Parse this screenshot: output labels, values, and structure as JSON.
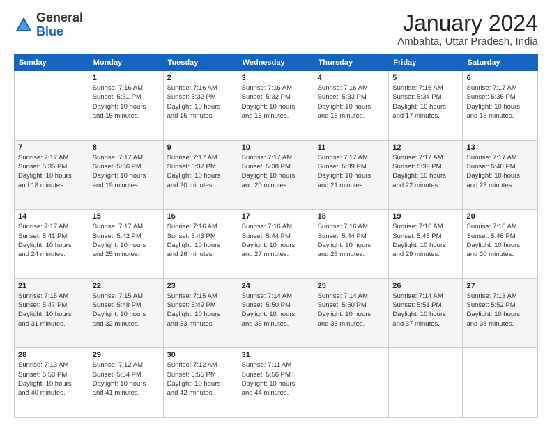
{
  "logo": {
    "general": "General",
    "blue": "Blue"
  },
  "header": {
    "title": "January 2024",
    "subtitle": "Ambahta, Uttar Pradesh, India"
  },
  "weekdays": [
    "Sunday",
    "Monday",
    "Tuesday",
    "Wednesday",
    "Thursday",
    "Friday",
    "Saturday"
  ],
  "weeks": [
    [
      {
        "day": "",
        "info": ""
      },
      {
        "day": "1",
        "info": "Sunrise: 7:16 AM\nSunset: 5:31 PM\nDaylight: 10 hours\nand 15 minutes."
      },
      {
        "day": "2",
        "info": "Sunrise: 7:16 AM\nSunset: 5:32 PM\nDaylight: 10 hours\nand 15 minutes."
      },
      {
        "day": "3",
        "info": "Sunrise: 7:16 AM\nSunset: 5:32 PM\nDaylight: 10 hours\nand 16 minutes."
      },
      {
        "day": "4",
        "info": "Sunrise: 7:16 AM\nSunset: 5:33 PM\nDaylight: 10 hours\nand 16 minutes."
      },
      {
        "day": "5",
        "info": "Sunrise: 7:16 AM\nSunset: 5:34 PM\nDaylight: 10 hours\nand 17 minutes."
      },
      {
        "day": "6",
        "info": "Sunrise: 7:17 AM\nSunset: 5:35 PM\nDaylight: 10 hours\nand 18 minutes."
      }
    ],
    [
      {
        "day": "7",
        "info": "Sunrise: 7:17 AM\nSunset: 5:35 PM\nDaylight: 10 hours\nand 18 minutes."
      },
      {
        "day": "8",
        "info": "Sunrise: 7:17 AM\nSunset: 5:36 PM\nDaylight: 10 hours\nand 19 minutes."
      },
      {
        "day": "9",
        "info": "Sunrise: 7:17 AM\nSunset: 5:37 PM\nDaylight: 10 hours\nand 20 minutes."
      },
      {
        "day": "10",
        "info": "Sunrise: 7:17 AM\nSunset: 5:38 PM\nDaylight: 10 hours\nand 20 minutes."
      },
      {
        "day": "11",
        "info": "Sunrise: 7:17 AM\nSunset: 5:39 PM\nDaylight: 10 hours\nand 21 minutes."
      },
      {
        "day": "12",
        "info": "Sunrise: 7:17 AM\nSunset: 5:39 PM\nDaylight: 10 hours\nand 22 minutes."
      },
      {
        "day": "13",
        "info": "Sunrise: 7:17 AM\nSunset: 5:40 PM\nDaylight: 10 hours\nand 23 minutes."
      }
    ],
    [
      {
        "day": "14",
        "info": "Sunrise: 7:17 AM\nSunset: 5:41 PM\nDaylight: 10 hours\nand 24 minutes."
      },
      {
        "day": "15",
        "info": "Sunrise: 7:17 AM\nSunset: 5:42 PM\nDaylight: 10 hours\nand 25 minutes."
      },
      {
        "day": "16",
        "info": "Sunrise: 7:16 AM\nSunset: 5:43 PM\nDaylight: 10 hours\nand 26 minutes."
      },
      {
        "day": "17",
        "info": "Sunrise: 7:16 AM\nSunset: 5:44 PM\nDaylight: 10 hours\nand 27 minutes."
      },
      {
        "day": "18",
        "info": "Sunrise: 7:16 AM\nSunset: 5:44 PM\nDaylight: 10 hours\nand 28 minutes."
      },
      {
        "day": "19",
        "info": "Sunrise: 7:16 AM\nSunset: 5:45 PM\nDaylight: 10 hours\nand 29 minutes."
      },
      {
        "day": "20",
        "info": "Sunrise: 7:16 AM\nSunset: 5:46 PM\nDaylight: 10 hours\nand 30 minutes."
      }
    ],
    [
      {
        "day": "21",
        "info": "Sunrise: 7:15 AM\nSunset: 5:47 PM\nDaylight: 10 hours\nand 31 minutes."
      },
      {
        "day": "22",
        "info": "Sunrise: 7:15 AM\nSunset: 5:48 PM\nDaylight: 10 hours\nand 32 minutes."
      },
      {
        "day": "23",
        "info": "Sunrise: 7:15 AM\nSunset: 5:49 PM\nDaylight: 10 hours\nand 33 minutes."
      },
      {
        "day": "24",
        "info": "Sunrise: 7:14 AM\nSunset: 5:50 PM\nDaylight: 10 hours\nand 35 minutes."
      },
      {
        "day": "25",
        "info": "Sunrise: 7:14 AM\nSunset: 5:50 PM\nDaylight: 10 hours\nand 36 minutes."
      },
      {
        "day": "26",
        "info": "Sunrise: 7:14 AM\nSunset: 5:51 PM\nDaylight: 10 hours\nand 37 minutes."
      },
      {
        "day": "27",
        "info": "Sunrise: 7:13 AM\nSunset: 5:52 PM\nDaylight: 10 hours\nand 38 minutes."
      }
    ],
    [
      {
        "day": "28",
        "info": "Sunrise: 7:13 AM\nSunset: 5:53 PM\nDaylight: 10 hours\nand 40 minutes."
      },
      {
        "day": "29",
        "info": "Sunrise: 7:12 AM\nSunset: 5:54 PM\nDaylight: 10 hours\nand 41 minutes."
      },
      {
        "day": "30",
        "info": "Sunrise: 7:12 AM\nSunset: 5:55 PM\nDaylight: 10 hours\nand 42 minutes."
      },
      {
        "day": "31",
        "info": "Sunrise: 7:11 AM\nSunset: 5:56 PM\nDaylight: 10 hours\nand 44 minutes."
      },
      {
        "day": "",
        "info": ""
      },
      {
        "day": "",
        "info": ""
      },
      {
        "day": "",
        "info": ""
      }
    ]
  ]
}
